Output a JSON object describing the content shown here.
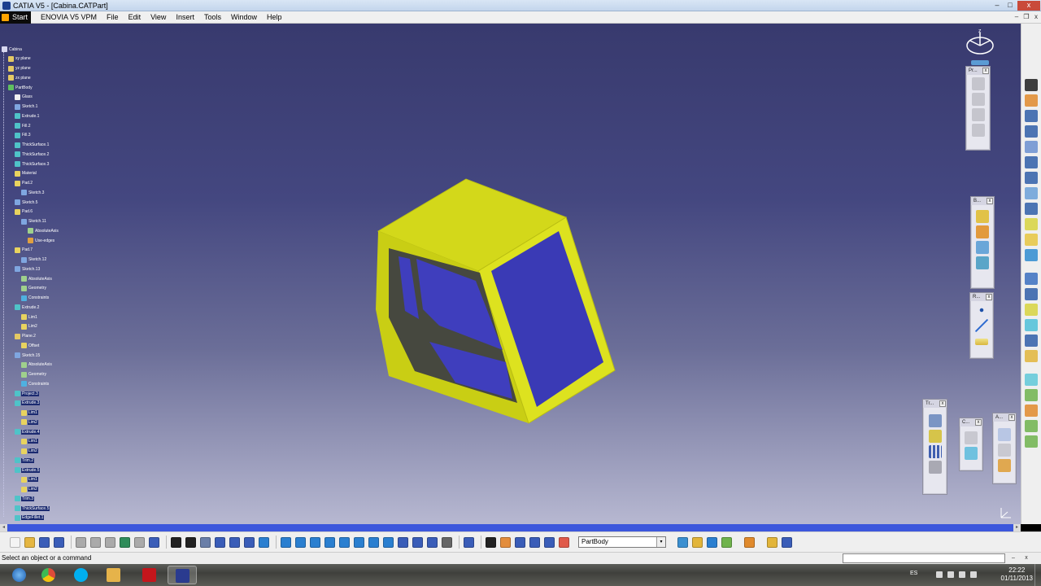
{
  "window": {
    "title": "CATIA V5 - [Cabina.CATPart]",
    "controls": {
      "minimize": "–",
      "maximize": "□",
      "close": "x"
    }
  },
  "menu": {
    "start": "Start",
    "items": [
      "ENOVIA V5 VPM",
      "File",
      "Edit",
      "View",
      "Insert",
      "Tools",
      "Window",
      "Help"
    ],
    "doc_controls": {
      "minimize": "–",
      "restore": "❐",
      "close": "x"
    }
  },
  "tree": {
    "nodes": [
      {
        "label": "Cabina",
        "icon": "part-icon",
        "color": "#d8d8f0"
      },
      {
        "label": "xy plane",
        "icon": "plane-icon",
        "color": "#e4c964"
      },
      {
        "label": "yz plane",
        "icon": "plane-icon",
        "color": "#e4c964"
      },
      {
        "label": "zx plane",
        "icon": "plane-icon",
        "color": "#e4c964"
      },
      {
        "label": "PartBody",
        "icon": "body-icon",
        "color": "#5fbf5f"
      },
      {
        "label": "Glass",
        "icon": "material-icon",
        "color": "#f0f0f0"
      },
      {
        "label": "Sketch.1",
        "icon": "sketch-icon",
        "color": "#7fa6e0"
      },
      {
        "label": "Extrude.1",
        "icon": "extrude-icon",
        "color": "#4fc3c8"
      },
      {
        "label": "Fill.2",
        "icon": "fill-icon",
        "color": "#4fc3c8"
      },
      {
        "label": "Fill.3",
        "icon": "fill-icon",
        "color": "#4fc3c8"
      },
      {
        "label": "ThickSurface.1",
        "icon": "thick-surface-icon",
        "color": "#4fc3c8"
      },
      {
        "label": "ThickSurface.2",
        "icon": "thick-surface-icon",
        "color": "#4fc3c8"
      },
      {
        "label": "ThickSurface.3",
        "icon": "thick-surface-icon",
        "color": "#4fc3c8"
      },
      {
        "label": "Material",
        "icon": "material-icon",
        "color": "#e8d35f"
      },
      {
        "label": "Pad.2",
        "icon": "pad-icon",
        "color": "#e8d35f"
      },
      {
        "label": "Sketch.3",
        "icon": "sketch-icon",
        "color": "#7fa6e0"
      },
      {
        "label": "Sketch.5",
        "icon": "sketch-icon",
        "color": "#7fa6e0"
      },
      {
        "label": "Pad.6",
        "icon": "pad-icon",
        "color": "#e8d35f"
      },
      {
        "label": "Sketch.11",
        "icon": "sketch-icon",
        "color": "#7fa6e0"
      },
      {
        "label": "AbsoluteAxis",
        "icon": "axis-icon",
        "color": "#9fd08c"
      },
      {
        "label": "Use-edges",
        "icon": "use-edges-icon",
        "color": "#e0a040"
      },
      {
        "label": "Pad.7",
        "icon": "pad-icon",
        "color": "#e8d35f"
      },
      {
        "label": "Sketch.12",
        "icon": "sketch-icon",
        "color": "#7fa6e0"
      },
      {
        "label": "Sketch.13",
        "icon": "sketch-icon",
        "color": "#7fa6e0"
      },
      {
        "label": "AbsoluteAxis",
        "icon": "axis-icon",
        "color": "#9fd08c"
      },
      {
        "label": "Geometry",
        "icon": "geometry-icon",
        "color": "#9fd08c"
      },
      {
        "label": "Constraints",
        "icon": "constraints-icon",
        "color": "#4fb0e0"
      },
      {
        "label": "Extrude.2",
        "icon": "extrude-icon",
        "color": "#4fc3c8"
      },
      {
        "label": "Lim1",
        "icon": "limit-icon",
        "color": "#e8d35f"
      },
      {
        "label": "Lim2",
        "icon": "limit-icon",
        "color": "#e8d35f"
      },
      {
        "label": "Plane.2",
        "icon": "plane-icon",
        "color": "#e4c964"
      },
      {
        "label": "Offset",
        "icon": "offset-icon",
        "color": "#e8d35f"
      },
      {
        "label": "Sketch.15",
        "icon": "sketch-icon",
        "color": "#7fa6e0"
      },
      {
        "label": "AbsoluteAxis",
        "icon": "axis-icon",
        "color": "#9fd08c"
      },
      {
        "label": "Geometry",
        "icon": "geometry-icon",
        "color": "#9fd08c"
      },
      {
        "label": "Constraints",
        "icon": "constraints-icon",
        "color": "#4fb0e0"
      },
      {
        "label": "Project.3",
        "icon": "project-icon",
        "color": "#4fc3c8"
      },
      {
        "label": "Extrude.3",
        "icon": "extrude-icon",
        "color": "#4fc3c8"
      },
      {
        "label": "Lim1",
        "icon": "limit-icon",
        "color": "#e8d35f"
      },
      {
        "label": "Lim2",
        "icon": "limit-icon",
        "color": "#e8d35f"
      },
      {
        "label": "Extrude.4",
        "icon": "extrude-icon",
        "color": "#4fc3c8"
      },
      {
        "label": "Lim1",
        "icon": "limit-icon",
        "color": "#e8d35f"
      },
      {
        "label": "Lim2",
        "icon": "limit-icon",
        "color": "#e8d35f"
      },
      {
        "label": "Trim.2",
        "icon": "trim-icon",
        "color": "#4fc3c8"
      },
      {
        "label": "Extrude.5",
        "icon": "extrude-icon",
        "color": "#4fc3c8"
      },
      {
        "label": "Lim1",
        "icon": "limit-icon",
        "color": "#e8d35f"
      },
      {
        "label": "Lim2",
        "icon": "limit-icon",
        "color": "#e8d35f"
      },
      {
        "label": "Trim.3",
        "icon": "trim-icon",
        "color": "#4fc3c8"
      },
      {
        "label": "ThickSurface.5",
        "icon": "thick-surface-icon",
        "color": "#4fc3c8"
      },
      {
        "label": "EdgeFillet.1",
        "icon": "edge-fillet-icon",
        "color": "#4fc3c8"
      }
    ]
  },
  "toolboxes": [
    {
      "title": "Pr...",
      "close": "x",
      "icons": [
        "product-icon",
        "product-icon",
        "product-icon",
        "product-icon"
      ]
    },
    {
      "title": "B...",
      "close": "x",
      "icons": [
        "boolean-icon",
        "boolean-icon",
        "boolean-icon",
        "boolean-icon"
      ]
    },
    {
      "title": "R...",
      "close": "x",
      "icons": [
        "point-icon",
        "line-icon",
        "plane-icon"
      ]
    },
    {
      "title": "Tr...",
      "close": "x",
      "icons": [
        "translate-icon",
        "mirror-icon",
        "pattern-icon",
        "scale-icon"
      ]
    },
    {
      "title": "C...",
      "close": "x",
      "icons": [
        "constraint-icon",
        "constraint-icon"
      ]
    },
    {
      "title": "A...",
      "close": "x",
      "icons": [
        "annotation-icon",
        "annotation-icon",
        "annotation-icon"
      ]
    }
  ],
  "colors": {
    "part_yellow": "#d8dd1c",
    "glass_blue": "#3b39b8",
    "frame_dark": "#44463e",
    "viewport_top": "#383a6e",
    "viewport_bottom": "#b7b8d1",
    "scroll_blue": "#3c57dc"
  },
  "compass": {
    "axis_label": "z"
  },
  "right_toolbar": {
    "icons": [
      "sketcher-icon",
      "select-icon",
      "pad-icon",
      "pocket-icon",
      "shaft-icon",
      "hole-icon",
      "rib-icon",
      "slot-icon",
      "stiffener-icon",
      "multi-section-icon",
      "edge-fillet-icon",
      "chamfer-icon",
      "draft-icon",
      "shell-icon",
      "thickness-icon",
      "thread-icon",
      "remove-face-icon",
      "split-icon",
      "thick-surface-icon",
      "sew-icon",
      "apply-material-icon",
      "measure-icon",
      "analysis-icon"
    ]
  },
  "bottom_toolbar": {
    "icons": [
      "new-icon",
      "open-icon",
      "save-icon",
      "print-icon",
      "cut-icon",
      "copy-icon",
      "paste-icon",
      "undo-icon",
      "redo-icon",
      "whats-this-icon",
      "formula-icon",
      "knowledge-icon",
      "tools-icon",
      "table-icon",
      "catalog-icon",
      "publish-icon",
      "fly-icon",
      "fit-all-icon",
      "pan-icon",
      "rotate-icon",
      "zoom-in-icon",
      "zoom-out-icon",
      "normal-view-icon",
      "iso-view-icon",
      "view-mode-icon",
      "hide-show-icon",
      "swap-icon",
      "multi-view-icon",
      "compass-icon",
      "snapshot-icon",
      "update-icon",
      "hand-icon",
      "grid-icon",
      "3d-axis-icon",
      "render-icon",
      "param-icon"
    ],
    "body_select": "PartBody",
    "right_icons": [
      "part-body-icon",
      "insert-body-icon",
      "apply-icon",
      "refresh-icon",
      "material-icon",
      "sketch-icon",
      "options-icon"
    ]
  },
  "status": {
    "message": "Select an object or a command",
    "buttons": [
      "–",
      "x"
    ]
  },
  "taskbar": {
    "apps": [
      {
        "name": "start-orb-icon",
        "color": "#2d7fd0"
      },
      {
        "name": "chrome-icon",
        "color": "#dd4b39"
      },
      {
        "name": "skype-icon",
        "color": "#00aff0"
      },
      {
        "name": "explorer-folder-icon",
        "color": "#e6b34a"
      },
      {
        "name": "acrobat-icon",
        "color": "#c4161c"
      },
      {
        "name": "catia-app-icon",
        "color": "#2a3b8f"
      }
    ],
    "language": "ES",
    "time": "22:22",
    "date": "01/11/2013"
  }
}
